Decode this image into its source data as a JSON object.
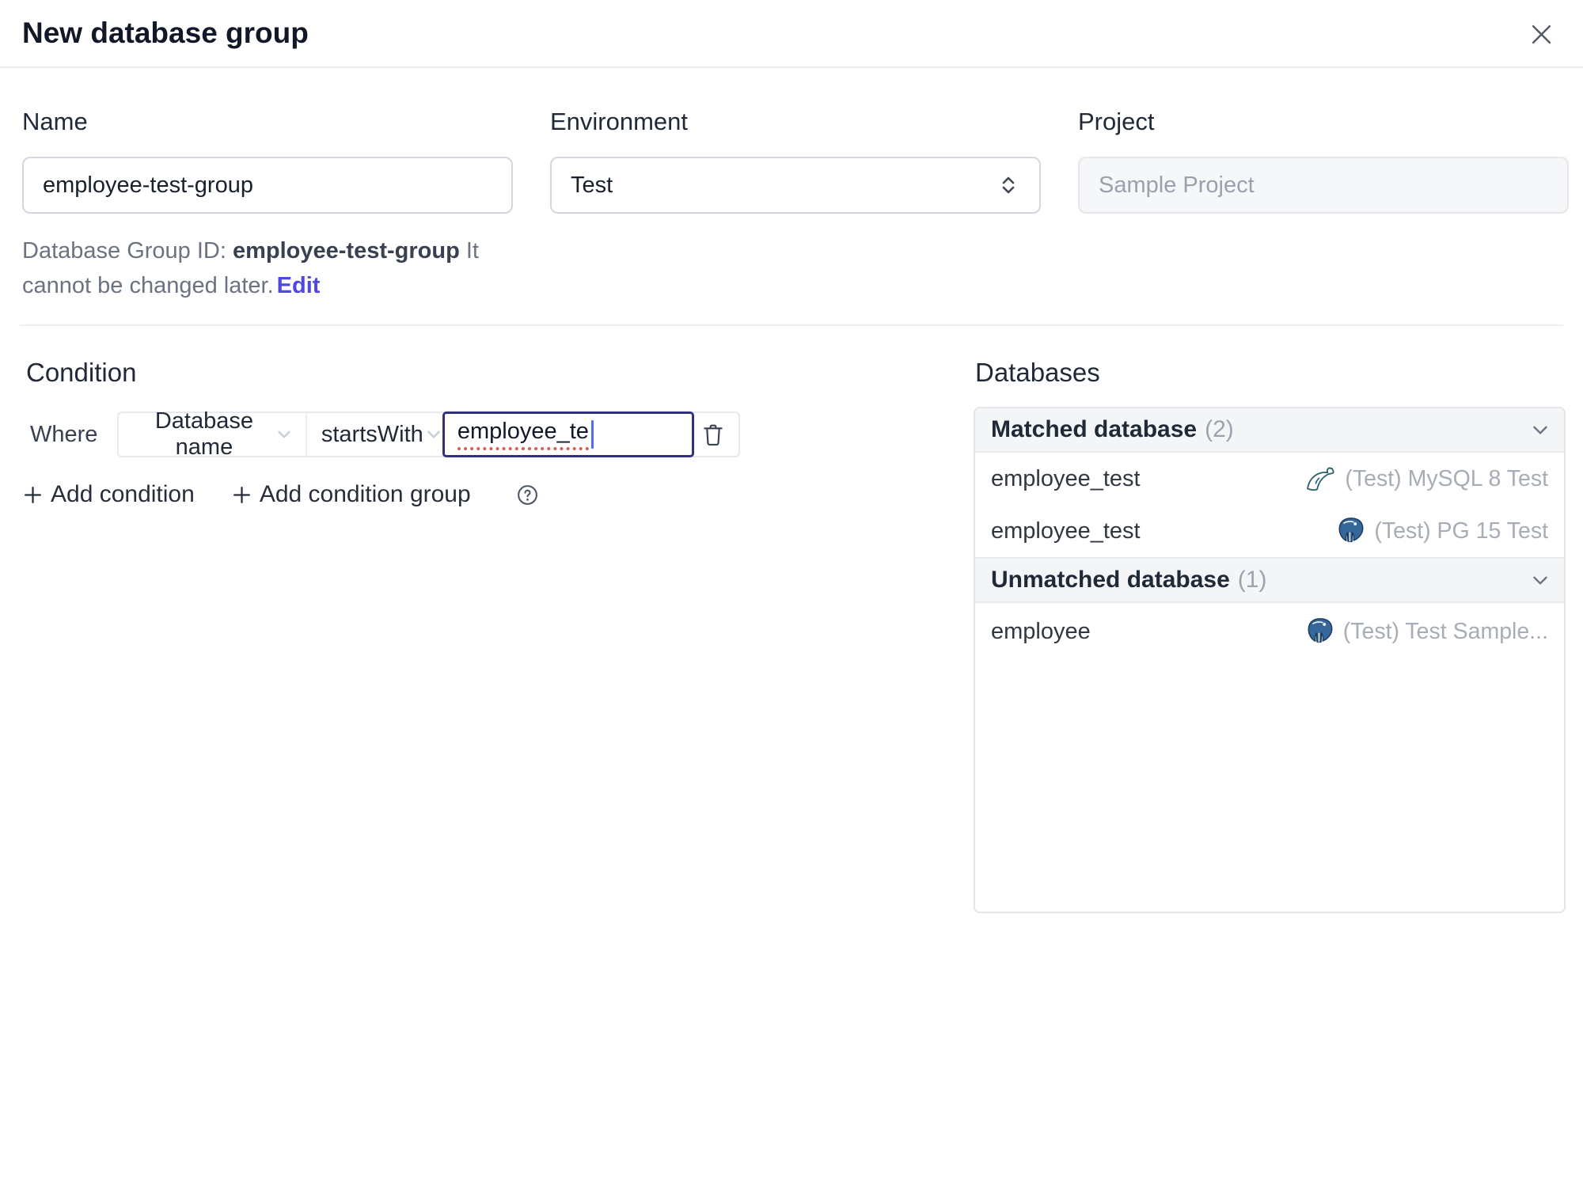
{
  "dialog": {
    "title": "New database group"
  },
  "form": {
    "name": {
      "label": "Name",
      "value": "employee-test-group"
    },
    "environment": {
      "label": "Environment",
      "value": "Test"
    },
    "project": {
      "label": "Project",
      "value": "Sample Project"
    },
    "group_id_helper": {
      "prefix": "Database Group ID: ",
      "id": "employee-test-group",
      "suffix": " It cannot be changed later.",
      "edit_label": "Edit"
    }
  },
  "condition": {
    "heading": "Condition",
    "where_label": "Where",
    "field": "Database name",
    "operator": "startsWith",
    "value": "employee_te",
    "add_condition_label": "Add condition",
    "add_condition_group_label": "Add condition group"
  },
  "databases": {
    "heading": "Databases",
    "groups": [
      {
        "title": "Matched database",
        "count": "(2)",
        "rows": [
          {
            "name": "employee_test",
            "engine": "mysql",
            "instance": "(Test) MySQL 8 Test"
          },
          {
            "name": "employee_test",
            "engine": "postgres",
            "instance": "(Test) PG 15 Test"
          }
        ]
      },
      {
        "title": "Unmatched database",
        "count": "(1)",
        "rows": [
          {
            "name": "employee",
            "engine": "postgres",
            "instance": "(Test) Test Sample..."
          }
        ]
      }
    ]
  },
  "colors": {
    "accent": "#4f46e5",
    "focus_border": "#34317c",
    "spellcheck_underline": "#e2594a",
    "mysql_icon": "#2a5f70",
    "postgres_icon": "#36679a",
    "header_bg": "#f4f5f7"
  }
}
